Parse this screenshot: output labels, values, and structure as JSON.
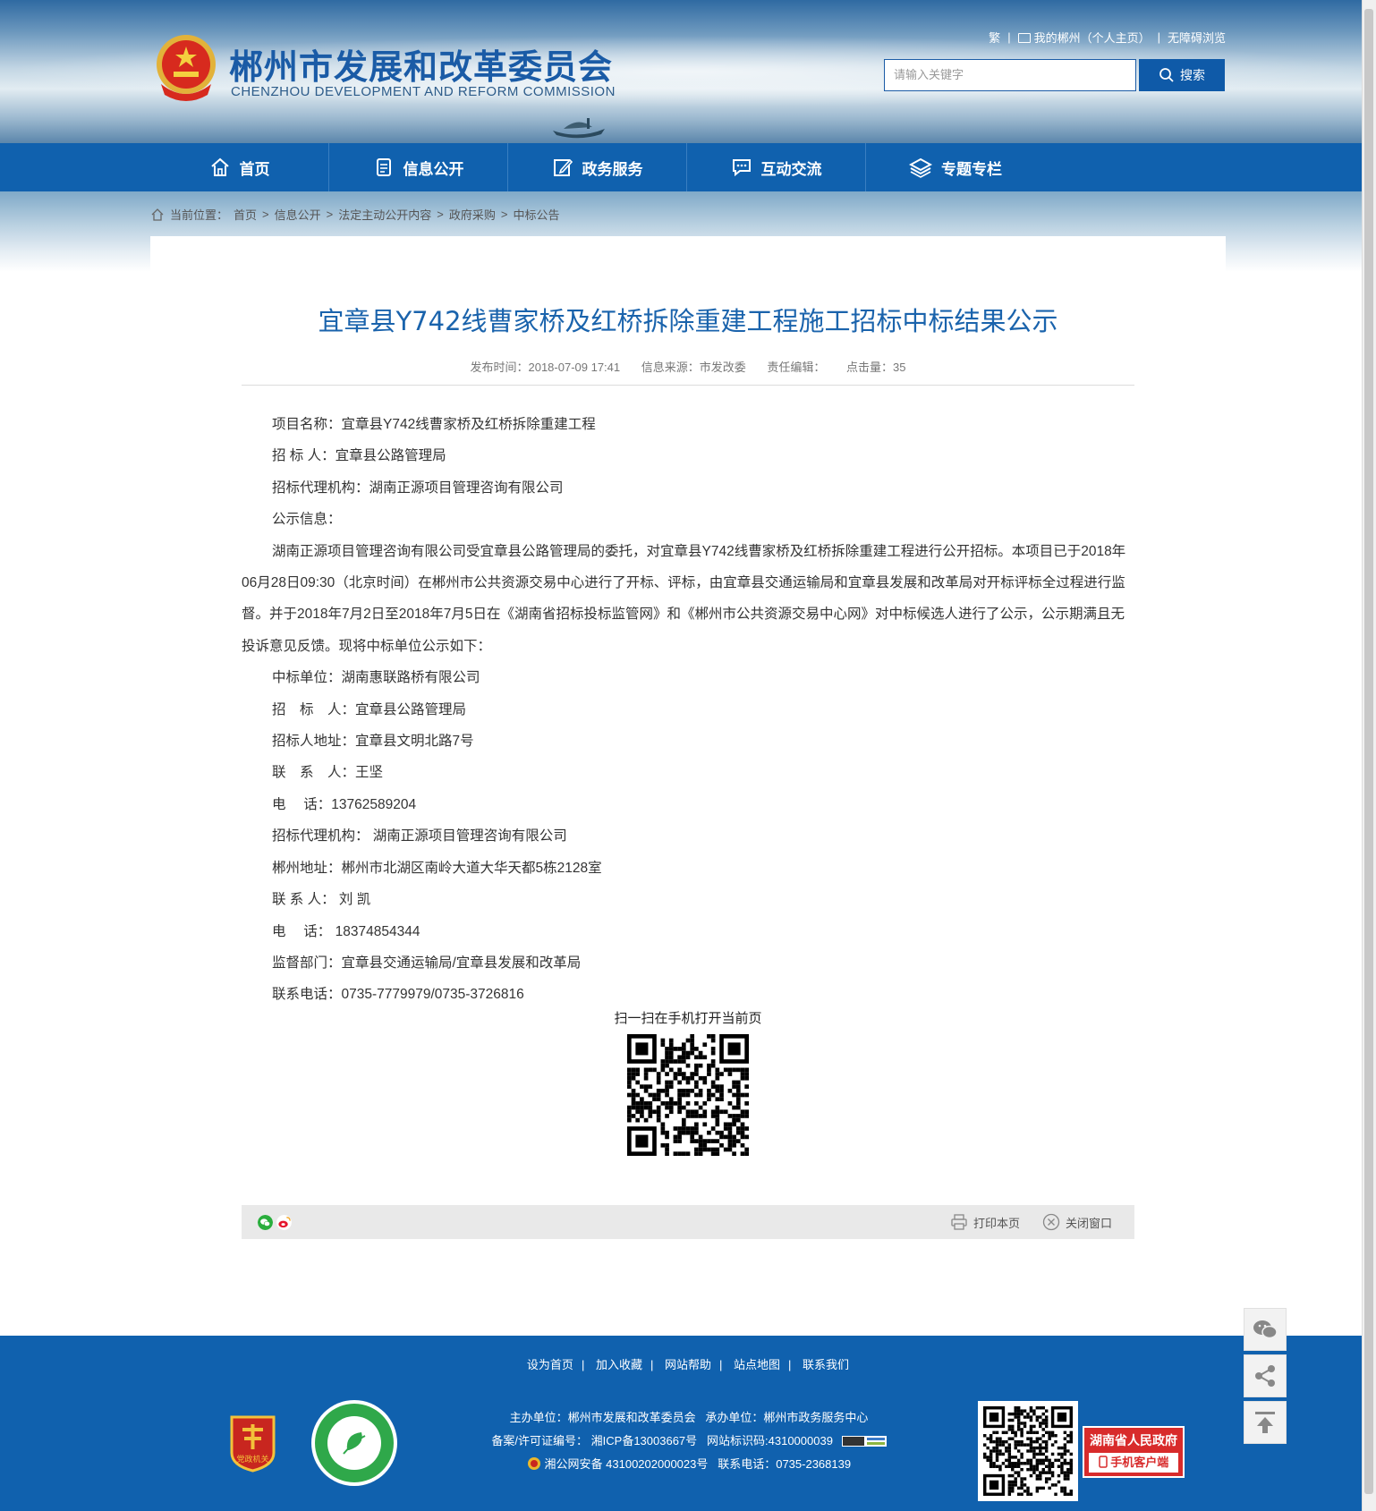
{
  "header": {
    "site_title": "郴州市发展和改革委员会",
    "site_subtitle": "CHENZHOU DEVELOPMENT AND REFORM COMMISSION",
    "top_links": [
      "繁",
      "我的郴州（个人主页）",
      "无障碍浏览"
    ],
    "search_placeholder": "请输入关键字",
    "search_button": "搜索"
  },
  "nav": [
    {
      "label": "首页",
      "icon": "home-icon"
    },
    {
      "label": "信息公开",
      "icon": "document-icon"
    },
    {
      "label": "政务服务",
      "icon": "edit-icon"
    },
    {
      "label": "互动交流",
      "icon": "chat-icon"
    },
    {
      "label": "专题专栏",
      "icon": "layers-icon"
    }
  ],
  "breadcrumb": {
    "prefix": "当前位置：",
    "items": [
      "首页",
      "信息公开",
      "法定主动公开内容",
      "政府采购",
      "中标公告"
    ],
    "separator": ">"
  },
  "article": {
    "title": "宜章县Y742线曹家桥及红桥拆除重建工程施工招标中标结果公示",
    "meta": {
      "publish_time": "发布时间：2018-07-09 17:41",
      "source": "信息来源：市发改委",
      "editor": "责任编辑：",
      "hits": "点击量：35"
    },
    "paragraphs": [
      "项目名称：宜章县Y742线曹家桥及红桥拆除重建工程",
      "招 标 人：宜章县公路管理局",
      "招标代理机构：湖南正源项目管理咨询有限公司",
      "公示信息：",
      "湖南正源项目管理咨询有限公司受宜章县公路管理局的委托，对宜章县Y742线曹家桥及红桥拆除重建工程进行公开招标。本项目已于2018年06月28日09:30（北京时间）在郴州市公共资源交易中心进行了开标、评标，由宜章县交通运输局和宜章县发展和改革局对开标评标全过程进行监督。并于2018年7月2日至2018年7月5日在《湖南省招标投标监管网》和《郴州市公共资源交易中心网》对中标候选人进行了公示，公示期满且无投诉意见反馈。现将中标单位公示如下：",
      "中标单位：湖南惠联路桥有限公司",
      "招　标　人：宜章县公路管理局",
      "招标人地址：宜章县文明北路7号",
      "联　系　人：王坚",
      "电　 话：13762589204",
      "招标代理机构： 湖南正源项目管理咨询有限公司",
      "郴州地址：郴州市北湖区南岭大道大华天都5栋2128室",
      "联  系 人： 刘 凯",
      "电　 话： 18374854344",
      "监督部门：宜章县交通运输局/宜章县发展和改革局",
      "联系电话：0735-7779979/0735-3726816"
    ],
    "qr_caption": "扫一扫在手机打开当前页"
  },
  "sharebar": {
    "print": "打印本页",
    "close": "关闭窗口",
    "share_icons": [
      "wechat-icon",
      "weibo-icon"
    ]
  },
  "footer": {
    "links": [
      "设为首页",
      "加入收藏",
      "网站帮助",
      "站点地图",
      "联系我们"
    ],
    "sponsor": "主办单位：郴州市发展和改革委员会",
    "organizer": "承办单位：郴州市政务服务中心",
    "icp": "备案/许可证编号： 湘ICP备13003667号",
    "site_code": "网站标识码:4310000039",
    "police": "湘公网安备 43100202000023号",
    "phone": "联系电话：0735-2368139",
    "badge_dang_text": "党政机关",
    "gov_badge_line1": "湖南省人民政府",
    "gov_badge_line2": "手机客户端"
  },
  "colors": {
    "primary": "#1061ae",
    "title": "#1a63ac",
    "gov_red": "#d82b2b"
  }
}
